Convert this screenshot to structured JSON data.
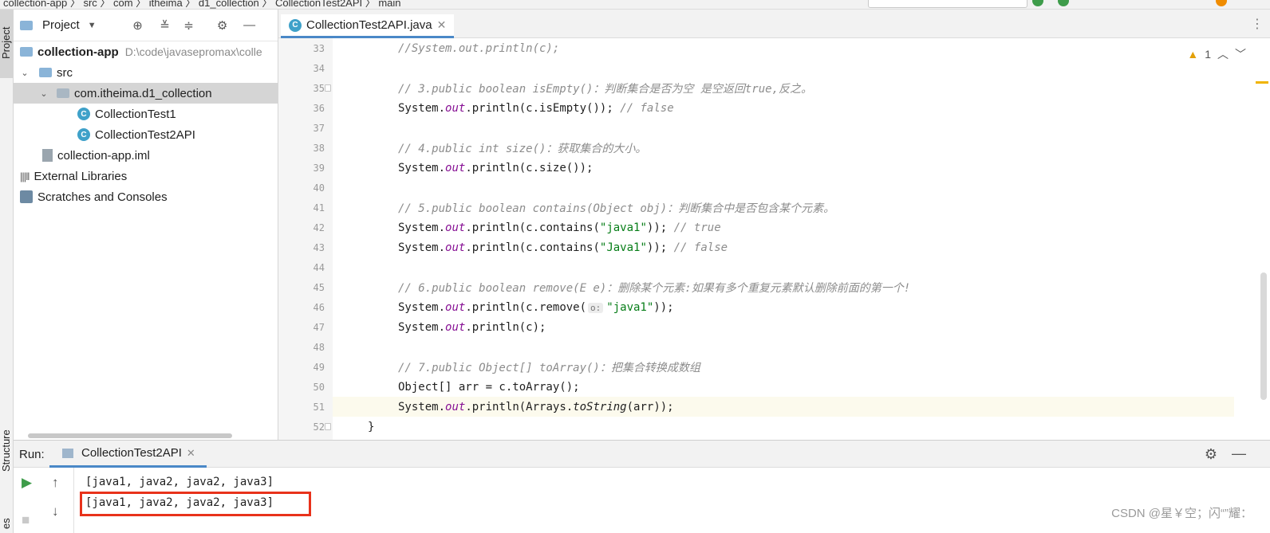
{
  "topbar": {
    "breadcrumb_text": "collection-app 〉 src 〉 com 〉 itheima 〉 d1_collection 〉 CollectionTest2API 〉 main",
    "colors": {
      "green": "#3e9c4a",
      "orange": "#f08c00"
    }
  },
  "left_strip": {
    "project_label": "Project",
    "structure_label": "Structure",
    "bookmarks_label": "es"
  },
  "project_panel": {
    "title": "Project",
    "tree": [
      {
        "label": "collection-app",
        "path": "D:\\code\\javasepromax\\colle",
        "kind": "module",
        "expanded": true
      },
      {
        "label": "src",
        "kind": "folder",
        "expanded": true
      },
      {
        "label": "com.itheima.d1_collection",
        "kind": "package",
        "expanded": true,
        "selected": true
      },
      {
        "label": "CollectionTest1",
        "kind": "class"
      },
      {
        "label": "CollectionTest2API",
        "kind": "class"
      },
      {
        "label": "collection-app.iml",
        "kind": "file"
      },
      {
        "label": "External Libraries",
        "kind": "libraries"
      },
      {
        "label": "Scratches and Consoles",
        "kind": "scratches"
      }
    ]
  },
  "editor": {
    "tab_label": "CollectionTest2API.java",
    "warning_count": "1",
    "lines": [
      {
        "num": "33",
        "parts": [
          [
            "cmt",
            "//System.out.println(c);"
          ]
        ]
      },
      {
        "num": "34",
        "parts": []
      },
      {
        "num": "35",
        "parts": [
          [
            "cmt",
            "// 3.public boolean isEmpty()：判断集合是否为空 是空返回true,反之。"
          ]
        ]
      },
      {
        "num": "36",
        "parts": [
          [
            "",
            "System."
          ],
          [
            "fld",
            "out"
          ],
          [
            "",
            ".println(c.isEmpty()); "
          ],
          [
            "cmt",
            "// false"
          ]
        ]
      },
      {
        "num": "37",
        "parts": []
      },
      {
        "num": "38",
        "parts": [
          [
            "cmt",
            "// 4.public int size()：获取集合的大小。"
          ]
        ]
      },
      {
        "num": "39",
        "parts": [
          [
            "",
            "System."
          ],
          [
            "fld",
            "out"
          ],
          [
            "",
            ".println(c.size());"
          ]
        ]
      },
      {
        "num": "40",
        "parts": []
      },
      {
        "num": "41",
        "parts": [
          [
            "cmt",
            "// 5.public boolean contains(Object obj)：判断集合中是否包含某个元素。"
          ]
        ]
      },
      {
        "num": "42",
        "parts": [
          [
            "",
            "System."
          ],
          [
            "fld",
            "out"
          ],
          [
            "",
            ".println(c.contains("
          ],
          [
            "str",
            "\"java1\""
          ],
          [
            "",
            ")); "
          ],
          [
            "cmt",
            "// true"
          ]
        ]
      },
      {
        "num": "43",
        "parts": [
          [
            "",
            "System."
          ],
          [
            "fld",
            "out"
          ],
          [
            "",
            ".println(c.contains("
          ],
          [
            "str",
            "\"Java1\""
          ],
          [
            "",
            ")); "
          ],
          [
            "cmt",
            "// false"
          ]
        ]
      },
      {
        "num": "44",
        "parts": []
      },
      {
        "num": "45",
        "parts": [
          [
            "cmt",
            "// 6.public boolean remove(E e)：删除某个元素:如果有多个重复元素默认删除前面的第一个!"
          ]
        ]
      },
      {
        "num": "46",
        "parts": [
          [
            "",
            "System."
          ],
          [
            "fld",
            "out"
          ],
          [
            "",
            ".println(c.remove("
          ],
          [
            "hint",
            "o:"
          ],
          [
            "str",
            "\"java1\""
          ],
          [
            "",
            "));"
          ]
        ]
      },
      {
        "num": "47",
        "parts": [
          [
            "",
            "System."
          ],
          [
            "fld",
            "out"
          ],
          [
            "",
            ".println(c);"
          ]
        ]
      },
      {
        "num": "48",
        "parts": []
      },
      {
        "num": "49",
        "parts": [
          [
            "cmt",
            "// 7.public Object[] toArray()：把集合转换成数组"
          ]
        ]
      },
      {
        "num": "50",
        "parts": [
          [
            "",
            "Object[] arr = c.toArray();"
          ]
        ]
      },
      {
        "num": "51",
        "parts": [
          [
            "",
            "System."
          ],
          [
            "fld",
            "out"
          ],
          [
            "",
            ".println(Arrays."
          ],
          [
            "itl",
            "toString"
          ],
          [
            "",
            "(arr));"
          ]
        ],
        "current": true
      },
      {
        "num": "52",
        "parts": [
          [
            "",
            "}"
          ]
        ],
        "indent": "outer"
      }
    ]
  },
  "run_panel": {
    "label": "Run:",
    "tab_label": "CollectionTest2API",
    "output": [
      "[java1, java2, java2, java3]",
      "[java1, java2, java2, java3]"
    ],
    "highlight_color": "#e8321b"
  },
  "watermark": "CSDN @星￥空；闪“”耀："
}
